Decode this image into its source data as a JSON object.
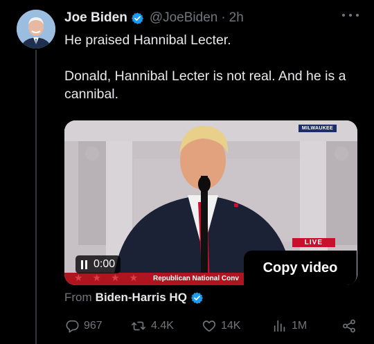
{
  "author": {
    "display_name": "Joe Biden",
    "handle": "@JoeBiden",
    "separator": "·",
    "time": "2h",
    "verified": true
  },
  "tweet": {
    "line1": "He praised Hannibal Lecter.",
    "line2": "Donald, Hannibal Lecter is not real. And he is a cannibal."
  },
  "media": {
    "overlay_top_right": "MILWAUKEE",
    "live_label": "LIVE",
    "chyron": "Republican National Conv",
    "stars": "★★★★",
    "timestamp": "0:00",
    "copy_video_label": "Copy video"
  },
  "source": {
    "prefix": "From",
    "name": "Biden-Harris HQ",
    "verified": true
  },
  "actions": {
    "replies": "967",
    "reposts": "4.4K",
    "likes": "14K",
    "views": "1M"
  },
  "colors": {
    "background": "#000000",
    "text": "#e7e9ea",
    "muted": "#71767b",
    "verified": "#1d9bf0",
    "thread_line": "#333639"
  },
  "icons": [
    "more-icon",
    "verified-badge-icon",
    "pause-icon",
    "reply-icon",
    "repost-icon",
    "like-icon",
    "views-icon",
    "share-icon"
  ]
}
